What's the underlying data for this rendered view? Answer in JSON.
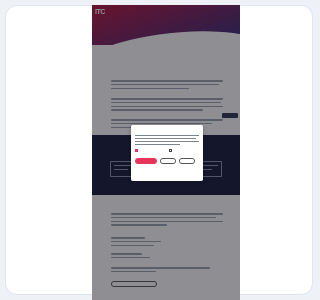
{
  "page": {
    "logo": "ITC",
    "nav": [
      "",
      "",
      "",
      ""
    ],
    "kicker": "",
    "title": "",
    "band_heading": "",
    "lower_title": "",
    "footer_button": ""
  },
  "dialog": {
    "title": "",
    "accept_label": "",
    "save_label": "",
    "reject_label": "",
    "option_1": "",
    "option_2": "",
    "link_1": "",
    "link_2": ""
  },
  "colors": {
    "accent": "#e6345a",
    "hero_start": "#b4123a",
    "hero_end": "#2a2f7a",
    "band": "#141a3a"
  }
}
